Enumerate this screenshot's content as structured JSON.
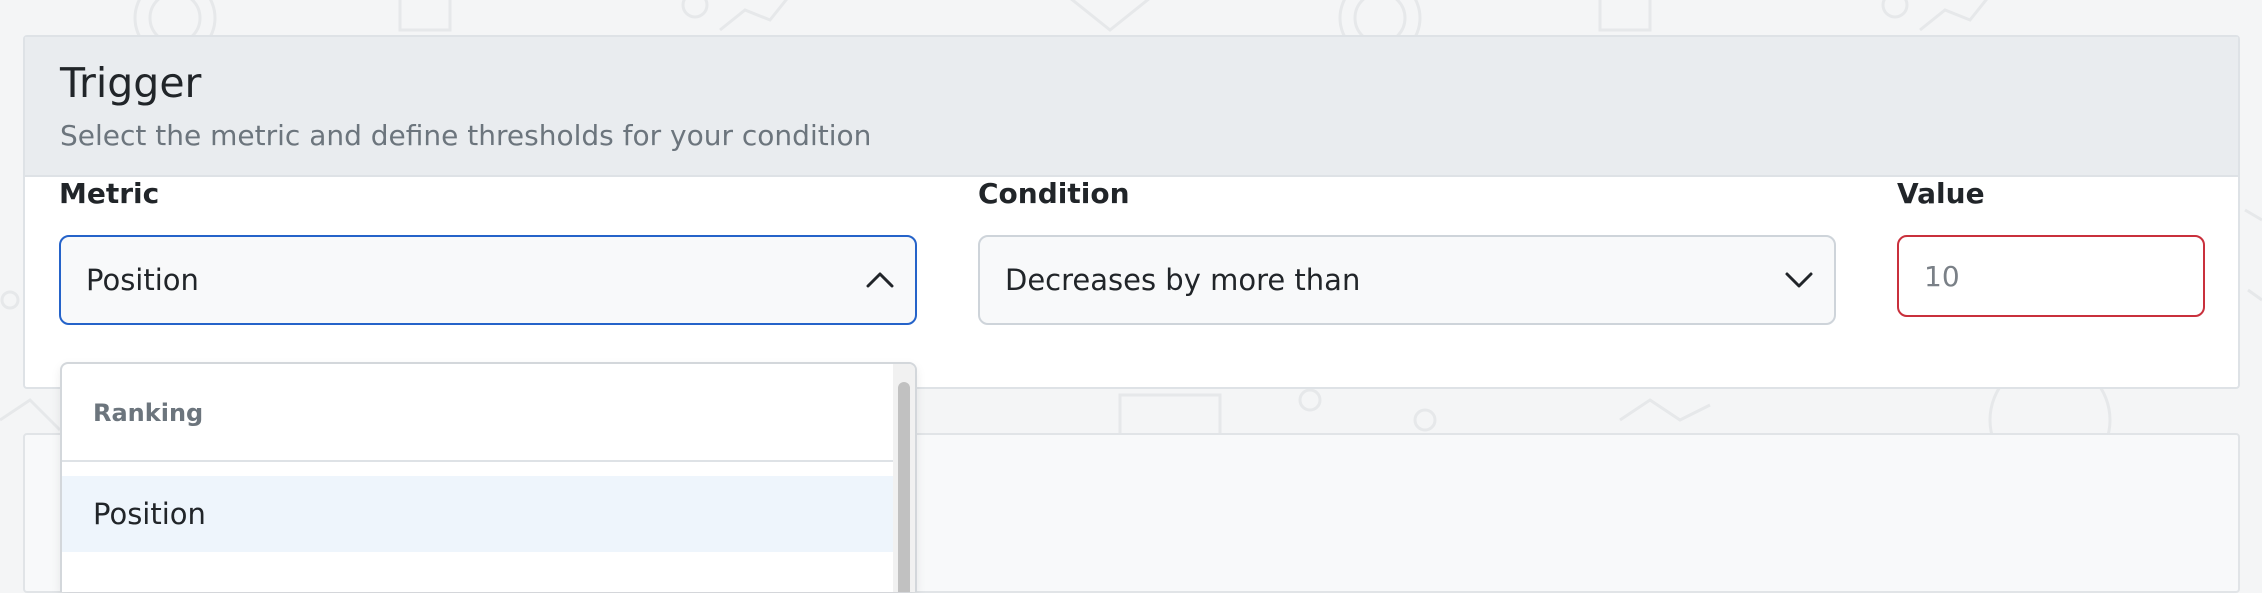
{
  "trigger_card": {
    "title": "Trigger",
    "subtitle": "Select the metric and define thresholds for your condition"
  },
  "metric_field": {
    "label": "Metric",
    "selected": "Position",
    "open": true
  },
  "condition_field": {
    "label": "Condition",
    "selected": "Decreases by more than"
  },
  "value_field": {
    "label": "Value",
    "placeholder": "10",
    "value": ""
  },
  "metric_dropdown": {
    "groups": [
      {
        "label": "Ranking",
        "options": [
          {
            "label": "Position",
            "highlighted": true
          }
        ]
      }
    ]
  },
  "colors": {
    "accent_focus": "#2563c9",
    "invalid_border": "#c9303c",
    "header_bg": "#e9ecef",
    "highlight_bg": "#eef5fc"
  }
}
